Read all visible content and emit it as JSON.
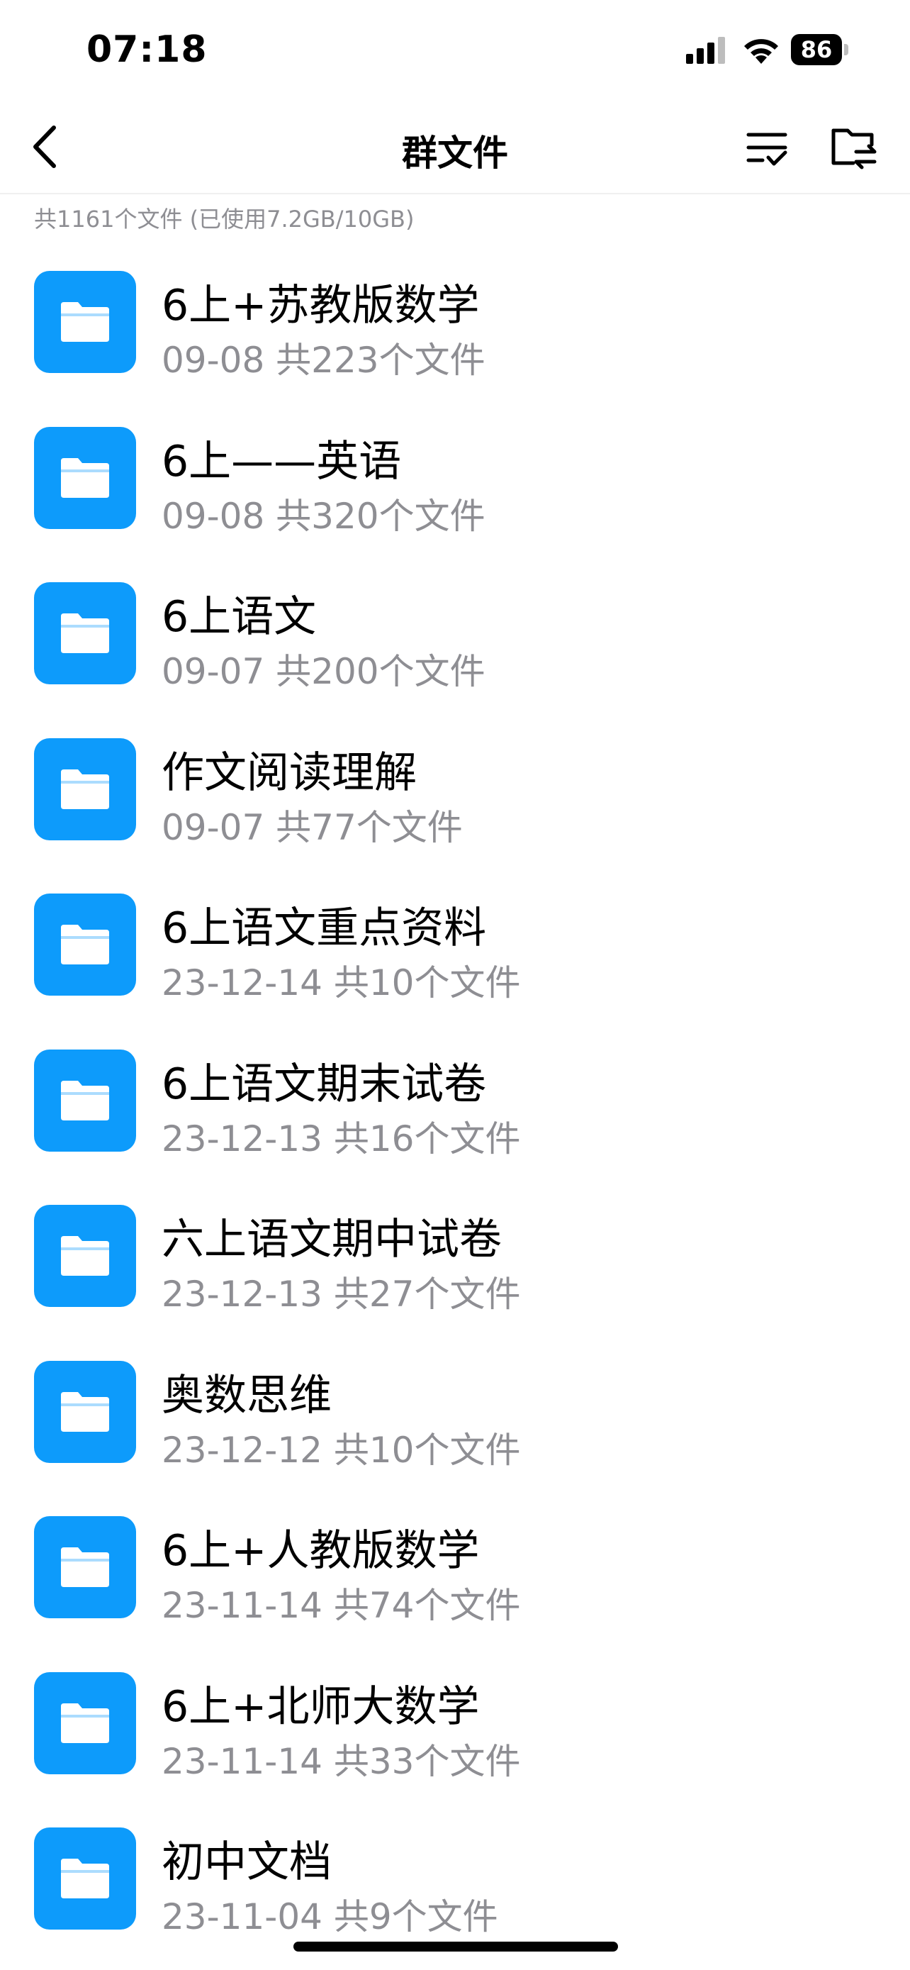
{
  "status_bar": {
    "time": "07:18",
    "battery": "86"
  },
  "nav": {
    "title": "群文件",
    "icons": {
      "back": "chevron-left-icon",
      "sort": "sort-list-icon",
      "transfer": "folder-transfer-icon"
    }
  },
  "storage_info": "共1161个文件 (已使用7.2GB/10GB)",
  "colors": {
    "folder": "#0d9bfb",
    "secondary_text": "#8e8e93"
  },
  "files": [
    {
      "name": "6上+苏教版数学",
      "meta": "09-08 共223个文件"
    },
    {
      "name": "6上——英语",
      "meta": "09-08 共320个文件"
    },
    {
      "name": "6上语文",
      "meta": "09-07 共200个文件"
    },
    {
      "name": "作文阅读理解",
      "meta": "09-07 共77个文件"
    },
    {
      "name": "6上语文重点资料",
      "meta": "23-12-14 共10个文件"
    },
    {
      "name": "6上语文期末试卷",
      "meta": "23-12-13 共16个文件"
    },
    {
      "name": "六上语文期中试卷",
      "meta": "23-12-13 共27个文件"
    },
    {
      "name": "奥数思维",
      "meta": "23-12-12 共10个文件"
    },
    {
      "name": "6上+人教版数学",
      "meta": "23-11-14 共74个文件"
    },
    {
      "name": "6上+北师大数学",
      "meta": "23-11-14 共33个文件"
    },
    {
      "name": "初中文档",
      "meta": "23-11-04 共9个文件"
    }
  ]
}
